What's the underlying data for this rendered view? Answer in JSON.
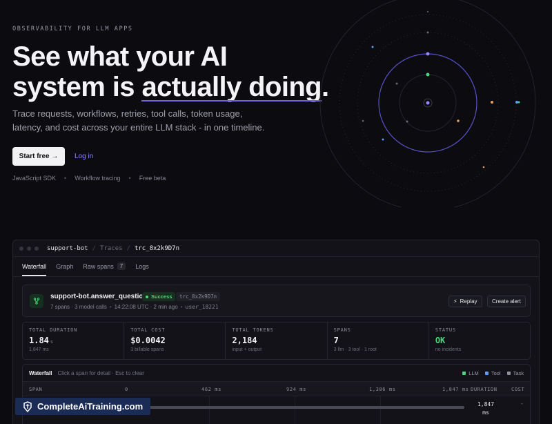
{
  "hero": {
    "eyebrow": "OBSERVABILITY FOR LLM APPS",
    "headline_line1": "See what your AI",
    "headline_pre": "system is ",
    "headline_highlight": "actually doing",
    "headline_post": ".",
    "subtitle": "Trace requests, workflows, retries, tool calls, token usage, latency, and cost across your entire LLM stack - in one timeline.",
    "cta_primary": "Start free →",
    "cta_secondary": "Log in",
    "features": [
      "JavaScript SDK",
      "Workflow tracing",
      "Free beta"
    ],
    "feature_sep": "•"
  },
  "colors": {
    "accent": "#6f67d9",
    "link": "#8f88ff",
    "success": "#4cd47a",
    "llm": "#4cd47a",
    "tool": "#5b9bff",
    "task": "#8e8e99"
  },
  "app": {
    "breadcrumb": [
      "support-bot",
      "Traces",
      "trc_8x2k9D7n"
    ],
    "breadcrumb_sep": "/",
    "tabs": [
      {
        "label": "Waterfall",
        "active": true
      },
      {
        "label": "Graph"
      },
      {
        "label": "Raw spans",
        "badge": "7"
      },
      {
        "label": "Logs"
      }
    ],
    "trace": {
      "icon": "branch-icon",
      "name": "support-bot.answer_question",
      "status": "Success",
      "trace_id": "trc_8x2k9D7n",
      "meta": [
        "7 spans · 3 model calls",
        "14:22:08 UTC · 2 min ago",
        "user_18221"
      ],
      "meta_sep": "•",
      "replay_label": "Replay",
      "alert_label": "Create alert"
    },
    "stats": [
      {
        "label": "TOTAL DURATION",
        "value": "1.84",
        "unit": "s",
        "sub": "1,847 ms"
      },
      {
        "label": "TOTAL COST",
        "value": "$0.0042",
        "sub": "3 billable spans"
      },
      {
        "label": "TOTAL TOKENS",
        "value": "2,184",
        "sub": "input + output"
      },
      {
        "label": "SPANS",
        "value": "7",
        "sub": "3 llm · 3 tool · 1 root"
      },
      {
        "label": "STATUS",
        "value": "OK",
        "sub": "no incidents"
      }
    ],
    "waterfall": {
      "title": "Waterfall",
      "hint": "Click a span for detail · Esc to clear",
      "legend": [
        "LLM",
        "Tool",
        "Task"
      ],
      "columns": {
        "span": "SPAN",
        "t0": "0",
        "t1": "462 ms",
        "t2": "924 ms",
        "t3": "1,386 ms",
        "t4": "1,847 ms",
        "duration": "DURATION",
        "cost": "COST"
      },
      "rows": [
        {
          "progress": 1.0,
          "duration": "1,847 ms",
          "cost": "-"
        }
      ]
    }
  },
  "watermark": {
    "text": "CompleteAiTraining.com"
  }
}
